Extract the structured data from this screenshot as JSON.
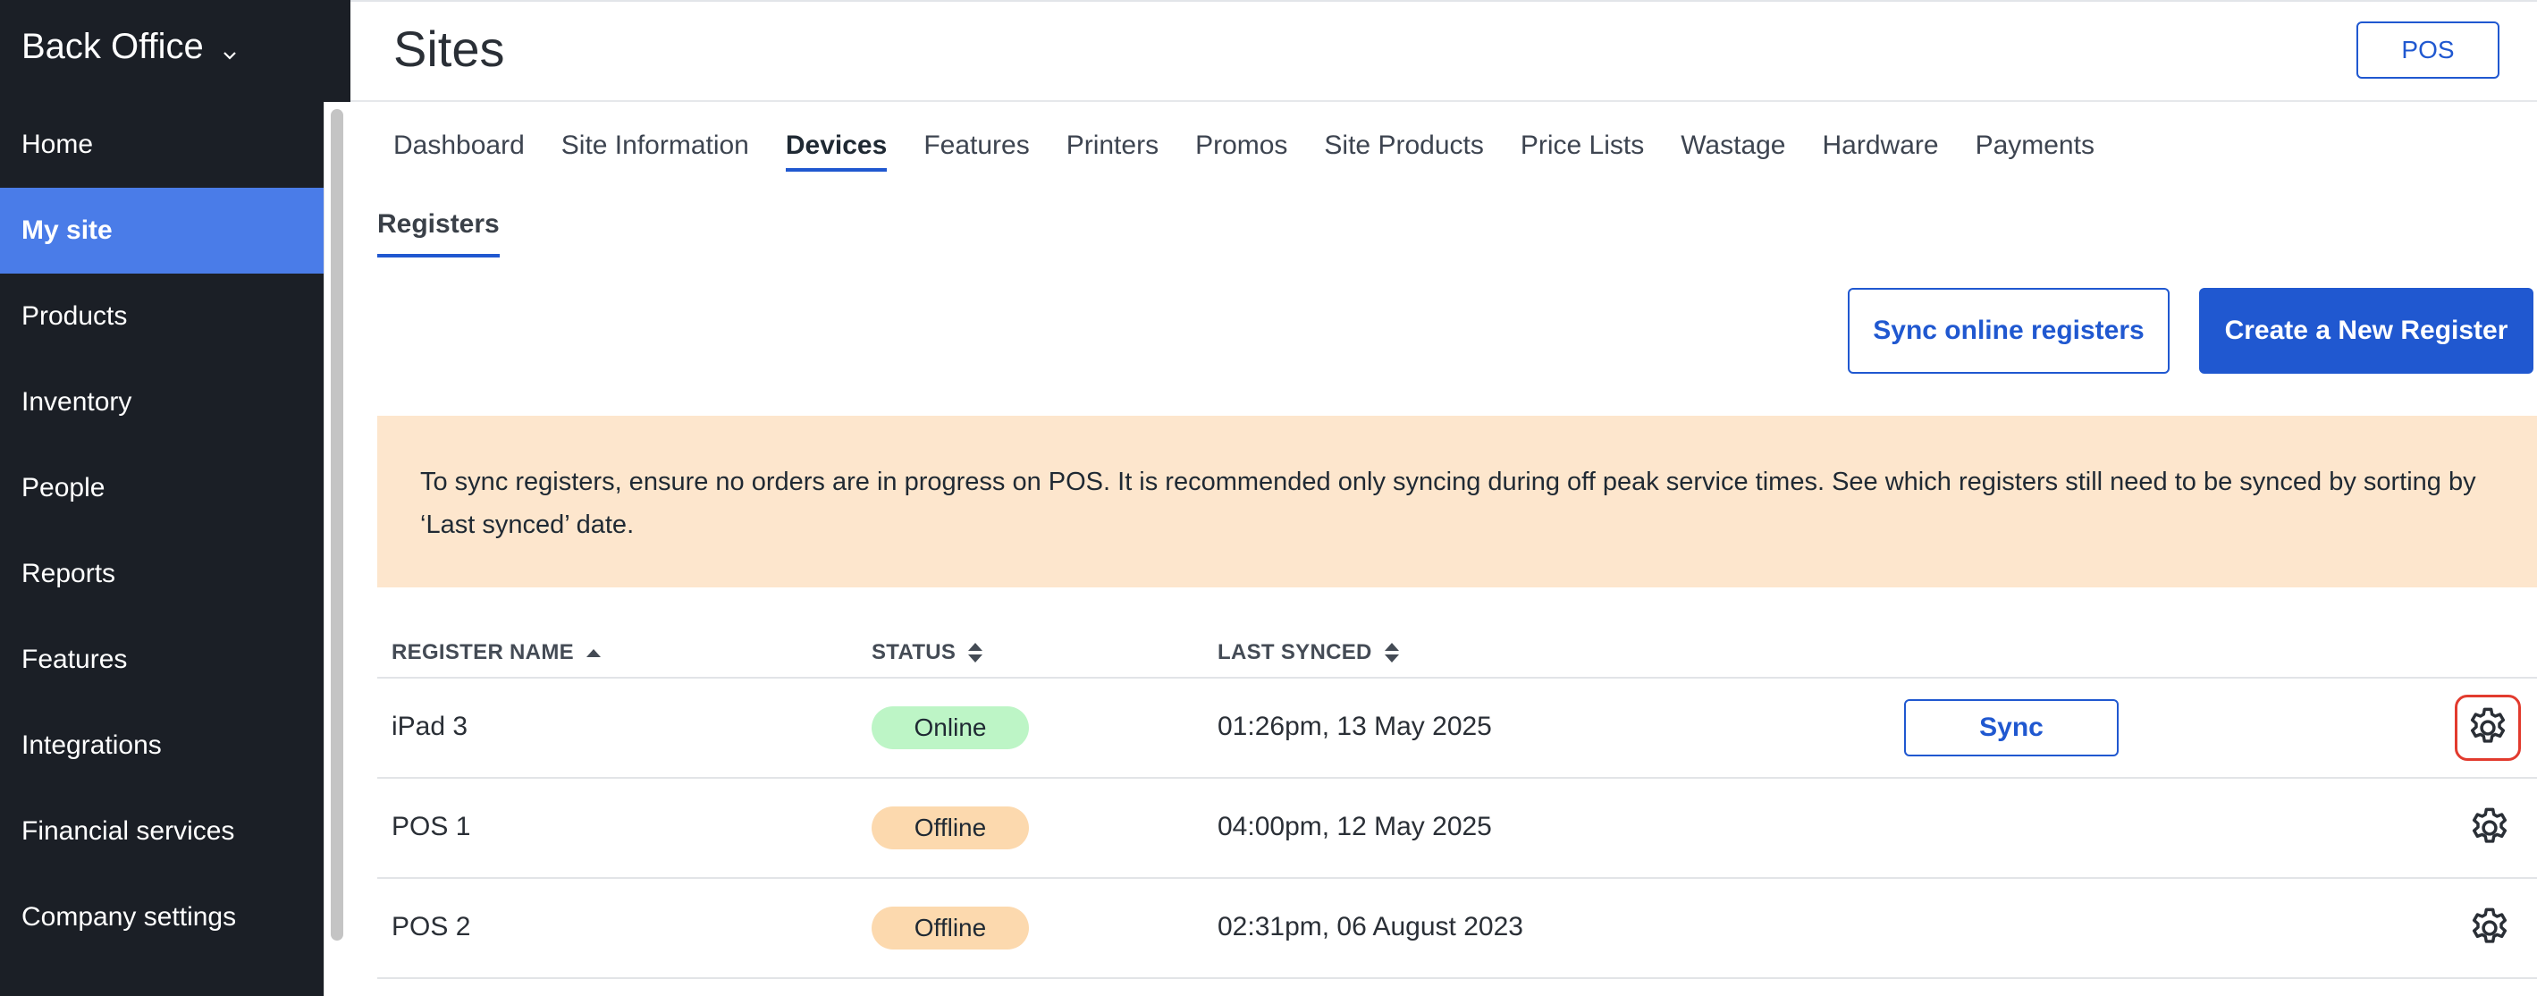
{
  "sidebar": {
    "brand": "Back Office",
    "items": [
      {
        "label": "Home"
      },
      {
        "label": "My site"
      },
      {
        "label": "Products"
      },
      {
        "label": "Inventory"
      },
      {
        "label": "People"
      },
      {
        "label": "Reports"
      },
      {
        "label": "Features"
      },
      {
        "label": "Integrations"
      },
      {
        "label": "Financial services"
      },
      {
        "label": "Company settings"
      }
    ]
  },
  "header": {
    "title": "Sites",
    "pos_button": "POS"
  },
  "tabs": [
    {
      "label": "Dashboard"
    },
    {
      "label": "Site Information"
    },
    {
      "label": "Devices"
    },
    {
      "label": "Features"
    },
    {
      "label": "Printers"
    },
    {
      "label": "Promos"
    },
    {
      "label": "Site Products"
    },
    {
      "label": "Price Lists"
    },
    {
      "label": "Wastage"
    },
    {
      "label": "Hardware"
    },
    {
      "label": "Payments"
    }
  ],
  "subtab": "Registers",
  "actions": {
    "sync_online": "Sync online registers",
    "create_new": "Create a New Register"
  },
  "notice": "To sync registers, ensure no orders are in progress on POS. It is recommended only syncing during off peak service times. See which registers still need to be synced by sorting by ‘Last synced’ date.",
  "table": {
    "headers": {
      "name": "REGISTER NAME",
      "status": "STATUS",
      "last_synced": "LAST SYNCED"
    },
    "rows": [
      {
        "name": "iPad 3",
        "status": "Online",
        "last_synced": "01:26pm, 13 May 2025",
        "action": "Sync"
      },
      {
        "name": "POS 1",
        "status": "Offline",
        "last_synced": "04:00pm, 12 May 2025"
      },
      {
        "name": "POS 2",
        "status": "Offline",
        "last_synced": "02:31pm, 06 August 2023"
      }
    ]
  },
  "colors": {
    "accent": "#2058d0",
    "sidebar_bg": "#1b1f26",
    "sidebar_active": "#4a7ce8",
    "notice_bg": "#fde6cd",
    "online": "#bdf5c6",
    "offline": "#fcd9ae",
    "highlight": "#e23b2e"
  }
}
